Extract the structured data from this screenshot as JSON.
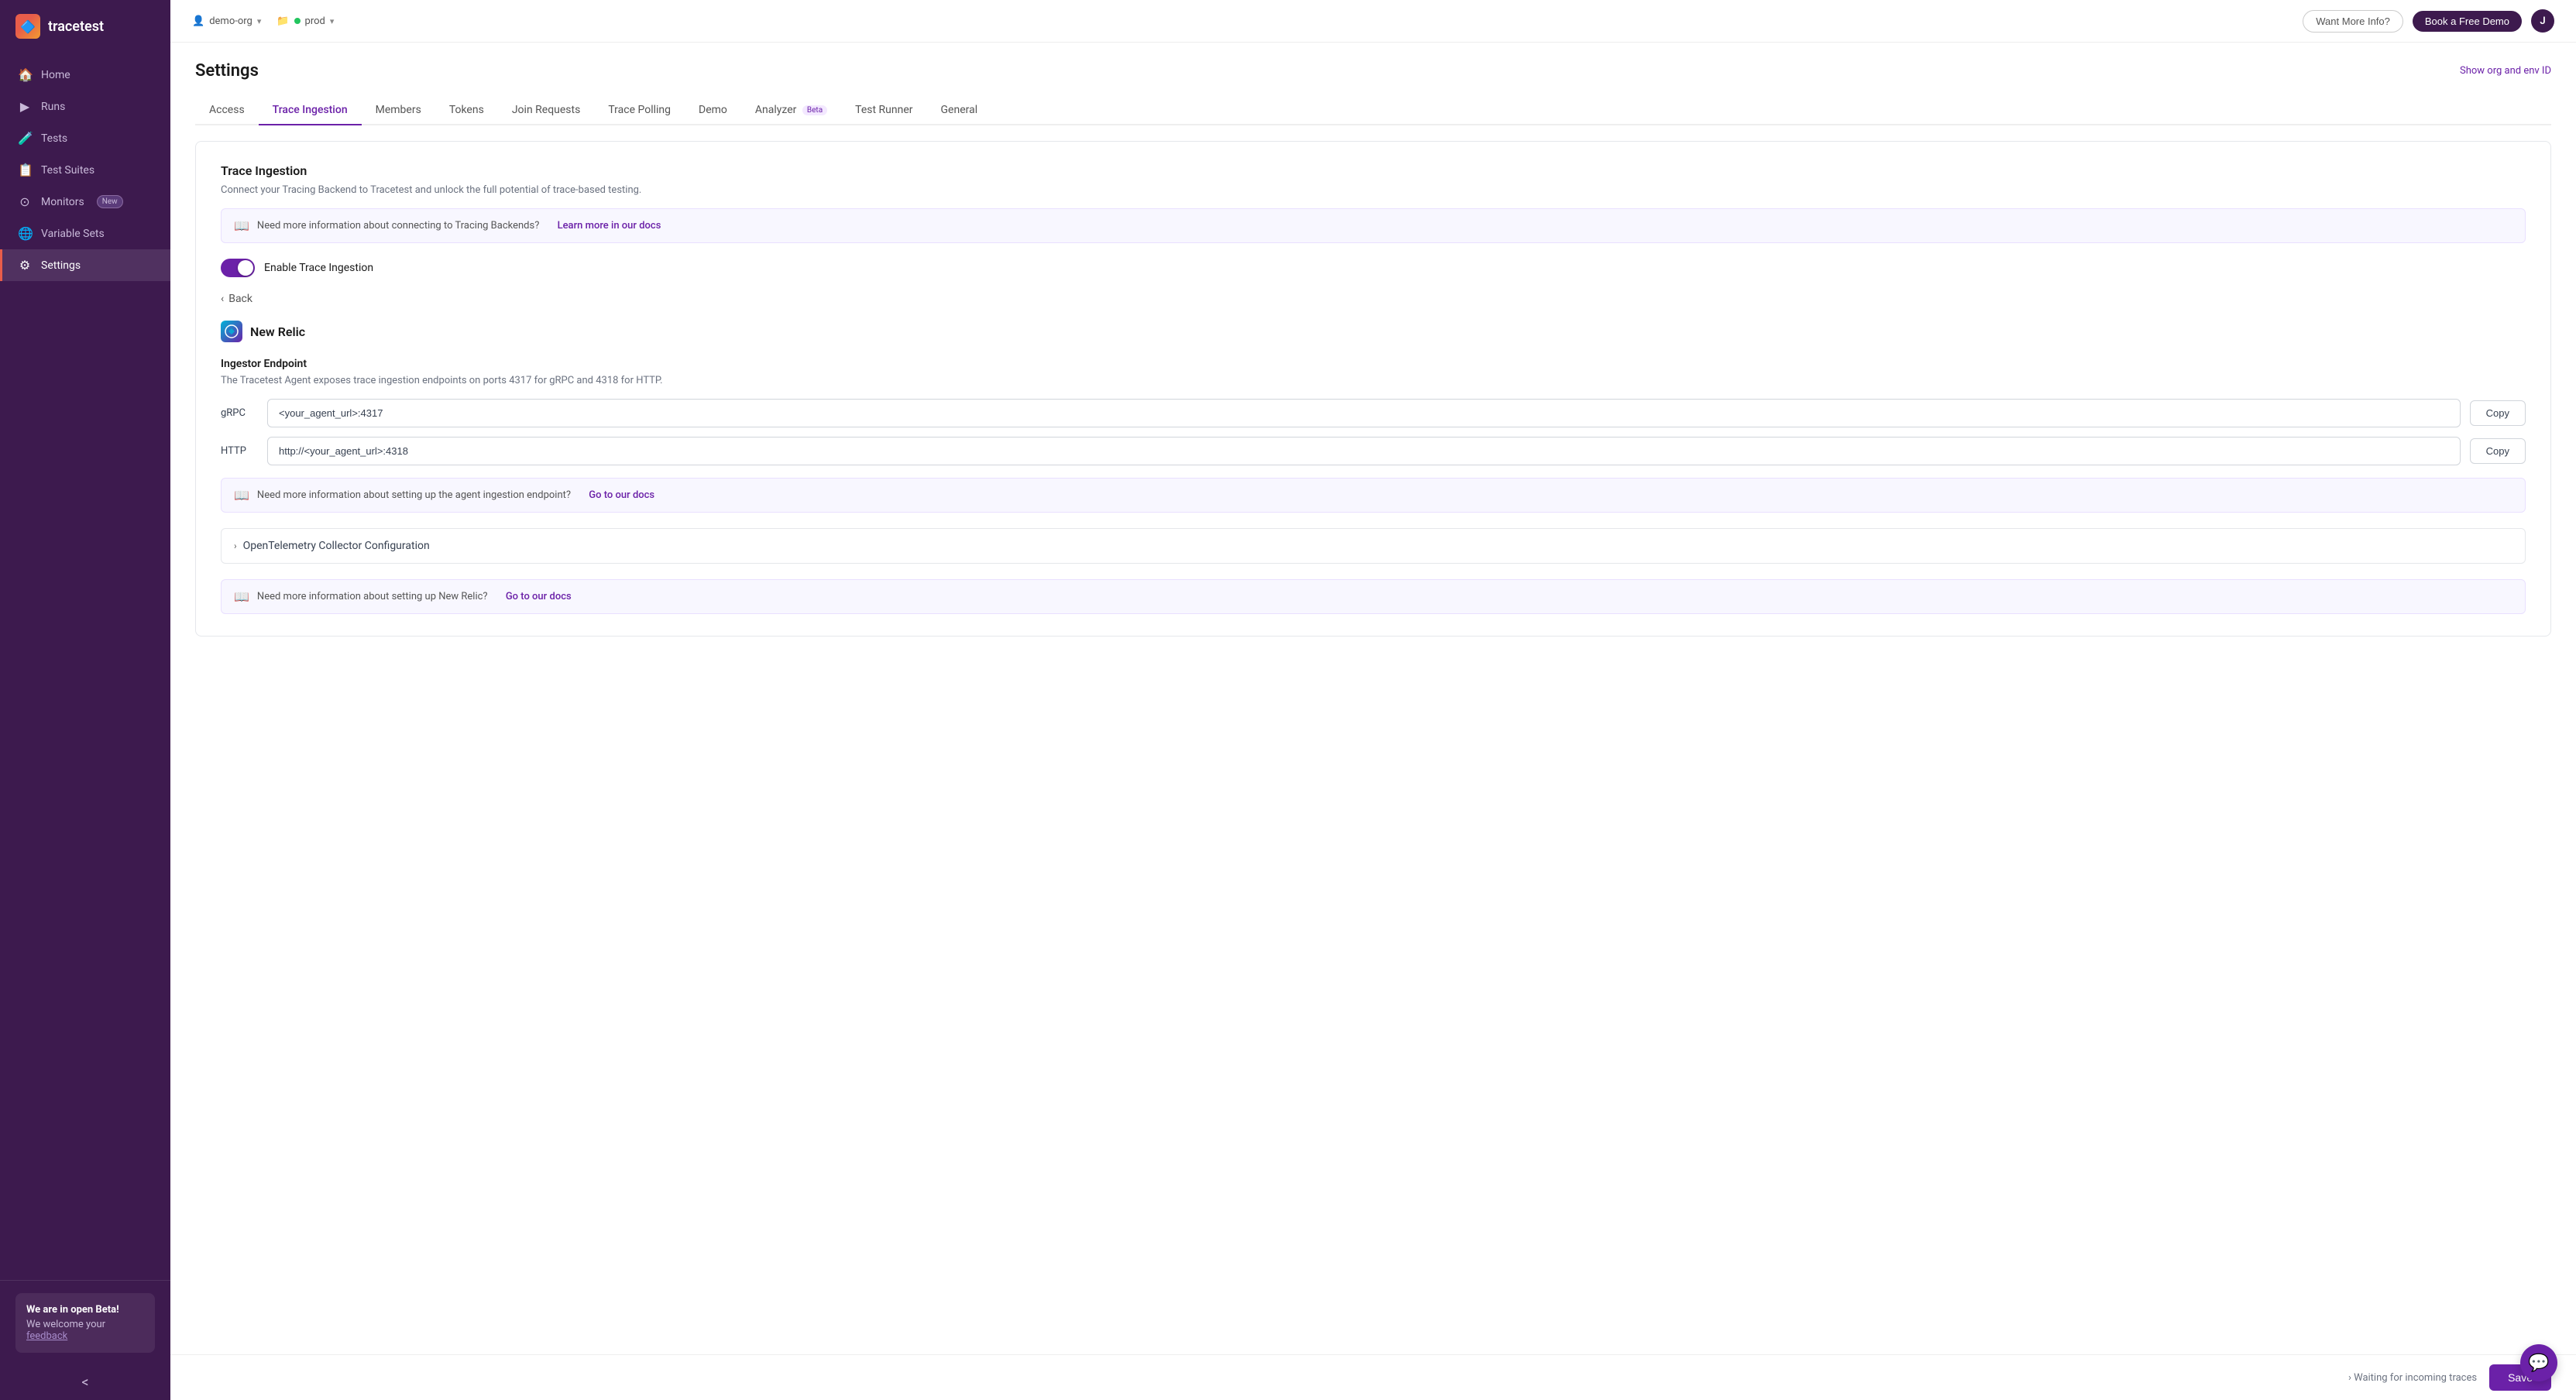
{
  "app": {
    "name": "tracetest",
    "logo_icon": "🔷"
  },
  "topbar": {
    "org": "demo-org",
    "env": "prod",
    "want_more_info": "Want More Info?",
    "book_demo": "Book a Free Demo",
    "avatar_initial": "J"
  },
  "sidebar": {
    "items": [
      {
        "id": "home",
        "label": "Home",
        "icon": "🏠",
        "active": false
      },
      {
        "id": "runs",
        "label": "Runs",
        "icon": "▶",
        "active": false
      },
      {
        "id": "tests",
        "label": "Tests",
        "icon": "🧪",
        "active": false
      },
      {
        "id": "test-suites",
        "label": "Test Suites",
        "icon": "📋",
        "active": false
      },
      {
        "id": "monitors",
        "label": "Monitors",
        "icon": "⊙",
        "active": false,
        "badge": "New"
      },
      {
        "id": "variable-sets",
        "label": "Variable Sets",
        "icon": "🌐",
        "active": false
      },
      {
        "id": "settings",
        "label": "Settings",
        "icon": "⚙",
        "active": true
      }
    ],
    "beta_box": {
      "title": "We are in open Beta!",
      "description": "We welcome your ",
      "link_text": "feedback"
    },
    "collapse_icon": "<"
  },
  "page": {
    "title": "Settings",
    "show_org_link": "Show org and env ID"
  },
  "tabs": [
    {
      "id": "access",
      "label": "Access",
      "active": false
    },
    {
      "id": "trace-ingestion",
      "label": "Trace Ingestion",
      "active": true
    },
    {
      "id": "members",
      "label": "Members",
      "active": false
    },
    {
      "id": "tokens",
      "label": "Tokens",
      "active": false
    },
    {
      "id": "join-requests",
      "label": "Join Requests",
      "active": false
    },
    {
      "id": "trace-polling",
      "label": "Trace Polling",
      "active": false
    },
    {
      "id": "demo",
      "label": "Demo",
      "active": false
    },
    {
      "id": "analyzer",
      "label": "Analyzer",
      "active": false,
      "badge": "Beta"
    },
    {
      "id": "test-runner",
      "label": "Test Runner",
      "active": false
    },
    {
      "id": "general",
      "label": "General",
      "active": false
    }
  ],
  "trace_ingestion": {
    "section_title": "Trace Ingestion",
    "section_desc": "Connect your Tracing Backend to Tracetest and unlock the full potential of trace-based testing.",
    "info_box": {
      "text": "Need more information about connecting to Tracing Backends?",
      "link": "Learn more in our docs"
    },
    "toggle_label": "Enable Trace Ingestion",
    "toggle_enabled": true,
    "back_label": "Back",
    "provider": {
      "name": "New Relic",
      "icon": "◈"
    },
    "ingestor": {
      "title": "Ingestor Endpoint",
      "desc": "The Tracetest Agent exposes trace ingestion endpoints on ports 4317 for gRPC and 4318 for HTTP.",
      "grpc_label": "gRPC",
      "grpc_value": "<your_agent_url>:4317",
      "http_label": "HTTP",
      "http_value": "http://<your_agent_url>:4318",
      "copy_label": "Copy"
    },
    "endpoint_info_box": {
      "text": "Need more information about setting up the agent ingestion endpoint?",
      "link": "Go to our docs"
    },
    "otel_section": {
      "label": "OpenTelemetry Collector Configuration",
      "expand_icon": "›"
    },
    "newrelic_info_box": {
      "text": "Need more information about setting up New Relic?",
      "link": "Go to our docs"
    }
  },
  "bottom_bar": {
    "waiting_text": "Waiting for incoming traces",
    "save_label": "Save"
  }
}
